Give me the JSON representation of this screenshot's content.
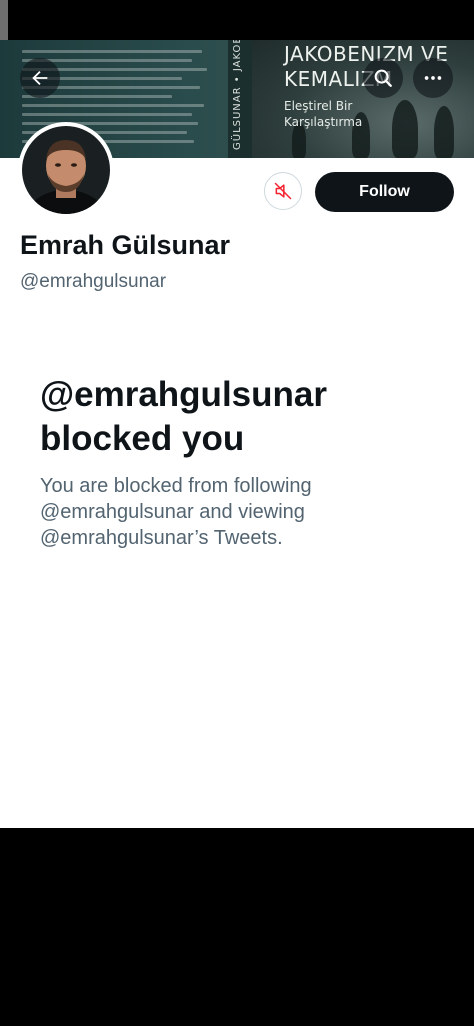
{
  "banner": {
    "cover_title_line1": "JAKOBENIZM VE",
    "cover_title_line2": "KEMALIZM",
    "cover_subtitle_line1": "Eleştirel Bir",
    "cover_subtitle_line2": "Karşılaştırma",
    "spine_text": "GÜLSUNAR • JAKOBENIZM"
  },
  "profile": {
    "display_name": "Emrah Gülsunar",
    "handle": "@emrahgulsunar",
    "follow_label": "Follow"
  },
  "blocked": {
    "title_line1": "@emrahgulsunar",
    "title_line2": "blocked you",
    "description": "You are blocked from following @emrahgulsunar and viewing @emrahgulsunar’s Tweets."
  },
  "icons": {
    "back": "arrow-left-icon",
    "search": "search-icon",
    "more": "more-dots-icon",
    "mute": "muted-speaker-icon"
  },
  "colors": {
    "follow_bg": "#0f1419",
    "secondary_text": "#536471",
    "mute_red": "#f4212e"
  }
}
